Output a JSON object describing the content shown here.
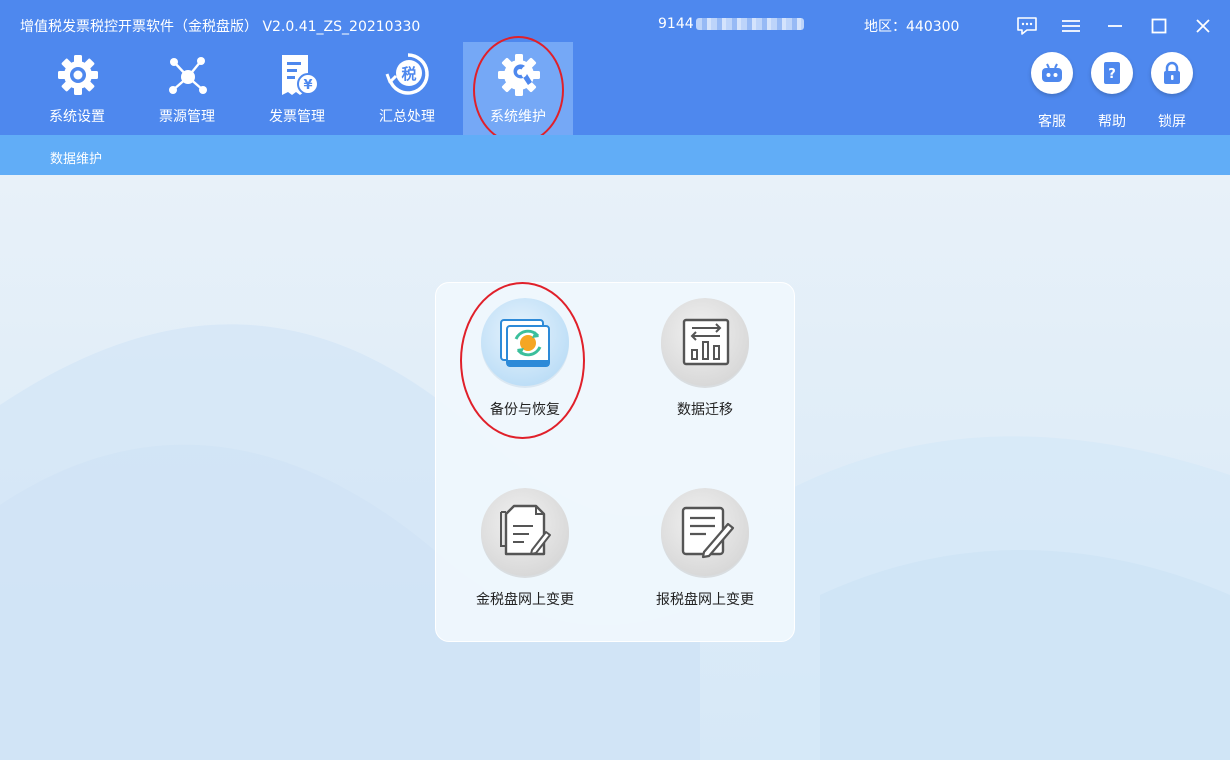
{
  "app_title": "增值税发票税控开票软件（金税盘版） V2.0.41_ZS_20210330",
  "tax_id_prefix": "9144",
  "region": "地区：440300",
  "nav_tabs": [
    {
      "label": "系统设置",
      "icon": "gear-icon",
      "active": false
    },
    {
      "label": "票源管理",
      "icon": "network-icon",
      "active": false
    },
    {
      "label": "发票管理",
      "icon": "invoice-icon",
      "active": false
    },
    {
      "label": "汇总处理",
      "icon": "tax-summary-icon",
      "active": false
    },
    {
      "label": "系统维护",
      "icon": "wrench-gear-icon",
      "active": true
    }
  ],
  "tools": [
    {
      "label": "客服",
      "icon": "robot-icon"
    },
    {
      "label": "帮助",
      "icon": "help-book-icon"
    },
    {
      "label": "锁屏",
      "icon": "lock-icon"
    }
  ],
  "window_controls": [
    "message-icon",
    "menu-icon",
    "minimize-icon",
    "maximize-icon",
    "close-icon"
  ],
  "sub_tab": "数据维护",
  "functions": [
    {
      "label": "备份与恢复",
      "icon": "backup-restore-icon",
      "highlighted": true
    },
    {
      "label": "数据迁移",
      "icon": "data-migration-icon",
      "highlighted": false
    },
    {
      "label": "金税盘网上变更",
      "icon": "golden-tax-change-icon",
      "highlighted": false
    },
    {
      "label": "报税盘网上变更",
      "icon": "tax-disk-change-icon",
      "highlighted": false
    }
  ],
  "colors": {
    "header_blue": "#4e88ee",
    "active_tab": "#75a8f6",
    "subbar_blue": "#61adf7",
    "content_bg": "#e4eef8",
    "annotation_red": "#e0202a"
  }
}
